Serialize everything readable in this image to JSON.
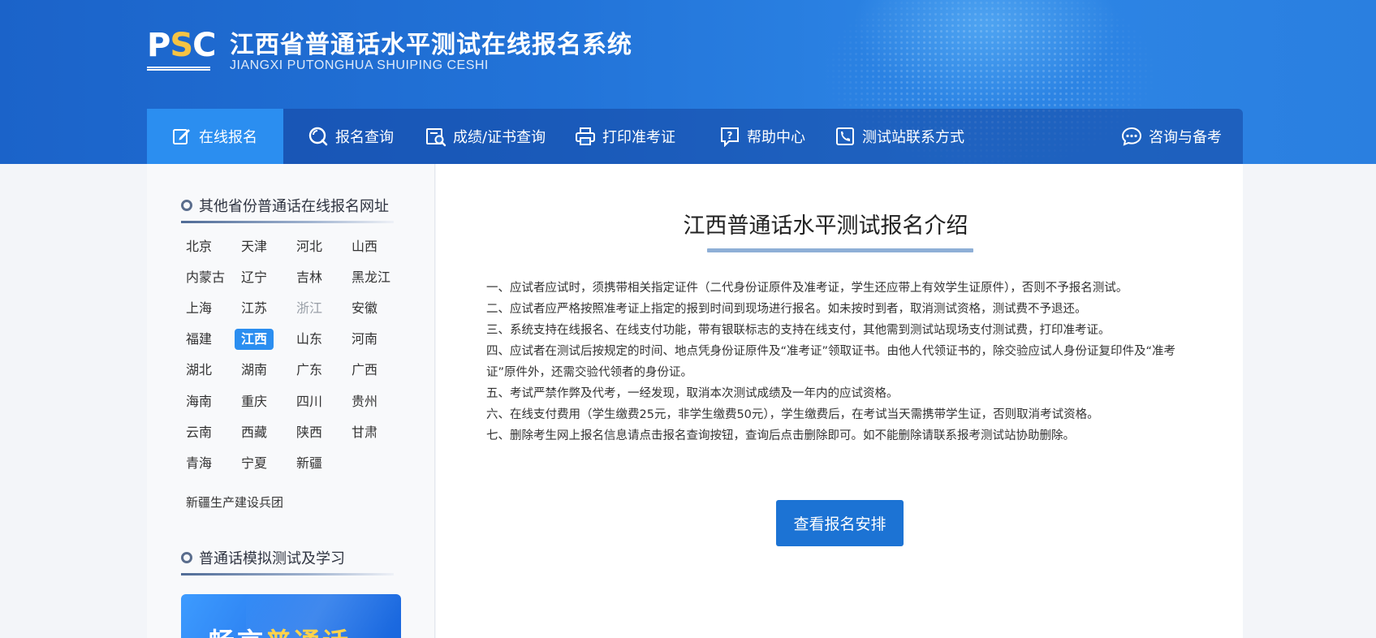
{
  "header": {
    "logo_text": "PSC",
    "title": "江西省普通话水平测试在线报名系统",
    "subtitle": "JIANGXI PUTONGHUA SHUIPING CESHI"
  },
  "nav": {
    "items": [
      {
        "label": "在线报名",
        "icon": "edit-icon",
        "active": true
      },
      {
        "label": "报名查询",
        "icon": "search-icon"
      },
      {
        "label": "成绩/证书查询",
        "icon": "certificate-search-icon"
      },
      {
        "label": "打印准考证",
        "icon": "printer-icon"
      },
      {
        "label": "帮助中心",
        "icon": "help-icon"
      },
      {
        "label": "测试站联系方式",
        "icon": "phone-icon"
      },
      {
        "label": "咨询与备考",
        "icon": "chat-icon"
      }
    ]
  },
  "sidebar": {
    "provinces_title": "其他省份普通话在线报名网址",
    "provinces": [
      [
        "北京",
        "天津",
        "河北",
        "山西"
      ],
      [
        "内蒙古",
        "辽宁",
        "吉林",
        "黑龙江"
      ],
      [
        "上海",
        "江苏",
        "浙江",
        "安徽"
      ],
      [
        "福建",
        "江西",
        "山东",
        "河南"
      ],
      [
        "湖北",
        "湖南",
        "广东",
        "广西"
      ],
      [
        "海南",
        "重庆",
        "四川",
        "贵州"
      ],
      [
        "云南",
        "西藏",
        "陕西",
        "甘肃"
      ],
      [
        "青海",
        "宁夏",
        "新疆"
      ]
    ],
    "selected_province": "江西",
    "disabled_province": "浙江",
    "extra_item": "新疆生产建设兵团",
    "study_title": "普通话模拟测试及学习",
    "banner_text_a": "畅言",
    "banner_text_b": "普通话"
  },
  "main": {
    "title": "江西普通话水平测试报名介绍",
    "rules": [
      "一、应试者应试时，须携带相关指定证件（二代身份证原件及准考证，学生还应带上有效学生证原件），否则不予报名测试。",
      "二、应试者应严格按照准考证上指定的报到时间到现场进行报名。如未按时到者，取消测试资格，测试费不予退还。",
      "三、系统支持在线报名、在线支付功能，带有银联标志的支持在线支付，其他需到测试站现场支付测试费，打印准考证。",
      "四、应试者在测试后按规定的时间、地点凭身份证原件及“准考证”领取证书。由他人代领证书的，除交验应试人身份证复印件及“准考证”原件外，还需交验代领者的身份证。",
      "五、考试严禁作弊及代考，一经发现，取消本次测试成绩及一年内的应试资格。",
      "六、在线支付费用（学生缴费25元，非学生缴费50元），学生缴费后，在考试当天需携带学生证，否则取消考试资格。",
      "七、删除考生网上报名信息请点击报名查询按钮，查询后点击删除即可。如不能删除请联系报考测试站协助删除。"
    ],
    "cta_label": "查看报名安排"
  }
}
